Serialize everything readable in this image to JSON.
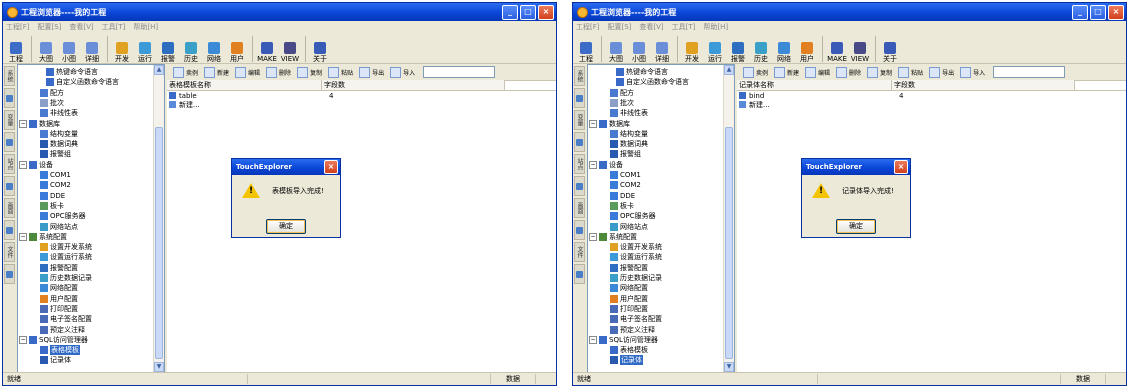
{
  "title": "工程浏览器----我的工程",
  "menu": [
    "工程[F]",
    "配置[S]",
    "查看[V]",
    "工具[T]",
    "帮助[H]"
  ],
  "toolbar": [
    {
      "label": "工程",
      "icon": "project-icon",
      "color": "#3d6cc8"
    },
    {
      "sep": true
    },
    {
      "label": "大图",
      "icon": "large-icons-icon",
      "color": "#6a8ed8"
    },
    {
      "label": "小图",
      "icon": "small-icons-icon",
      "color": "#6a8ed8"
    },
    {
      "label": "详细",
      "icon": "details-icon",
      "color": "#6a8ed8"
    },
    {
      "sep": true
    },
    {
      "label": "开发",
      "icon": "develop-icon",
      "color": "#e0a020"
    },
    {
      "label": "运行",
      "icon": "run-icon",
      "color": "#3c9ad8"
    },
    {
      "label": "报警",
      "icon": "alarm-icon",
      "color": "#2e6ec0"
    },
    {
      "label": "历史",
      "icon": "history-icon",
      "color": "#3aa0c8"
    },
    {
      "label": "网络",
      "icon": "network-icon",
      "color": "#3a8ad8"
    },
    {
      "label": "用户",
      "icon": "user-icon",
      "color": "#e08020"
    },
    {
      "sep": true
    },
    {
      "label": "MAKE",
      "icon": "make-icon",
      "color": "#3a5ab8"
    },
    {
      "label": "VIEW",
      "icon": "view-icon",
      "color": "#4a4a88"
    },
    {
      "sep": true
    },
    {
      "label": "关于",
      "icon": "about-icon",
      "color": "#3a5ab8"
    }
  ],
  "sidebar_tabs": [
    "系统",
    "变量",
    "站点",
    "画面",
    "文件"
  ],
  "tree": [
    {
      "text": "热键命令语言",
      "level": 3,
      "color": "#3a6ac8"
    },
    {
      "text": "自定义函数命令语言",
      "level": 3,
      "color": "#3a6ac8"
    },
    {
      "text": "配方",
      "level": 2,
      "color": "#4a7ad0"
    },
    {
      "text": "批次",
      "level": 2,
      "color": "#8aa0c8"
    },
    {
      "text": "非线性表",
      "level": 2,
      "color": "#4a7ad0"
    },
    {
      "text": "数据库",
      "level": 1,
      "expander": "−",
      "color": "#3a6ac8"
    },
    {
      "text": "结构变量",
      "level": 2,
      "color": "#4a7ad0"
    },
    {
      "text": "数据词典",
      "level": 2,
      "color": "#2a5ab0"
    },
    {
      "text": "报警组",
      "level": 2,
      "color": "#2a5ab0"
    },
    {
      "text": "设备",
      "level": 1,
      "expander": "−",
      "color": "#3a6ac8"
    },
    {
      "text": "COM1",
      "level": 2,
      "color": "#3a7ad8"
    },
    {
      "text": "COM2",
      "level": 2,
      "color": "#3a7ad8"
    },
    {
      "text": "DDE",
      "level": 2,
      "color": "#3a7ad8"
    },
    {
      "text": "板卡",
      "level": 2,
      "color": "#5a9a5a"
    },
    {
      "text": "OPC服务器",
      "level": 2,
      "color": "#3a7ad8"
    },
    {
      "text": "网络站点",
      "level": 2,
      "color": "#3a9ac8"
    },
    {
      "text": "系统配置",
      "level": 1,
      "expander": "−",
      "color": "#4a8a3a"
    },
    {
      "text": "设置开发系统",
      "level": 2,
      "color": "#e0a020"
    },
    {
      "text": "设置运行系统",
      "level": 2,
      "color": "#3c9ad8"
    },
    {
      "text": "报警配置",
      "level": 2,
      "color": "#2e6ec0"
    },
    {
      "text": "历史数据记录",
      "level": 2,
      "color": "#3aa0c8"
    },
    {
      "text": "网络配置",
      "level": 2,
      "color": "#3a8ad8"
    },
    {
      "text": "用户配置",
      "level": 2,
      "color": "#e08020"
    },
    {
      "text": "打印配置",
      "level": 2,
      "color": "#4a6ab8"
    },
    {
      "text": "电子签名配置",
      "level": 2,
      "color": "#4a6ab8"
    },
    {
      "text": "预定义注释",
      "level": 2,
      "color": "#4a6ab8"
    },
    {
      "text": "SQL访问管理器",
      "level": 1,
      "expander": "−",
      "color": "#3a6ac8"
    },
    {
      "text": "表格模板",
      "level": 2,
      "color": "#3a6ac8"
    },
    {
      "text": "记录体",
      "level": 2,
      "color": "#2a5ab0"
    }
  ],
  "subtoolbar": [
    {
      "label": "卖例",
      "icon": "example-icon"
    },
    {
      "label": "新建",
      "icon": "new-icon"
    },
    {
      "label": "编辑",
      "icon": "edit-icon"
    },
    {
      "label": "删除",
      "icon": "delete-icon"
    },
    {
      "label": "复制",
      "icon": "copy-icon"
    },
    {
      "label": "粘贴",
      "icon": "paste-icon"
    },
    {
      "label": "导出",
      "icon": "export-icon"
    },
    {
      "label": "导入",
      "icon": "import-icon"
    }
  ],
  "status": {
    "text": "就绪",
    "mode": "数据"
  },
  "panels": [
    {
      "selected_index": 27,
      "columns": [
        "表格模板名称",
        "字段数"
      ],
      "rows": [
        {
          "name": "table",
          "count": "4"
        },
        {
          "name": "新建...",
          "count": ""
        }
      ],
      "dialog": {
        "title": "TouchExplorer",
        "message": "表模板导入完成!",
        "ok": "确定"
      }
    },
    {
      "selected_index": 28,
      "columns": [
        "记录体名称",
        "字段数"
      ],
      "rows": [
        {
          "name": "bind",
          "count": "4"
        },
        {
          "name": "新建...",
          "count": ""
        }
      ],
      "dialog": {
        "title": "TouchExplorer",
        "message": "记录体导入完成!",
        "ok": "确定"
      }
    }
  ]
}
